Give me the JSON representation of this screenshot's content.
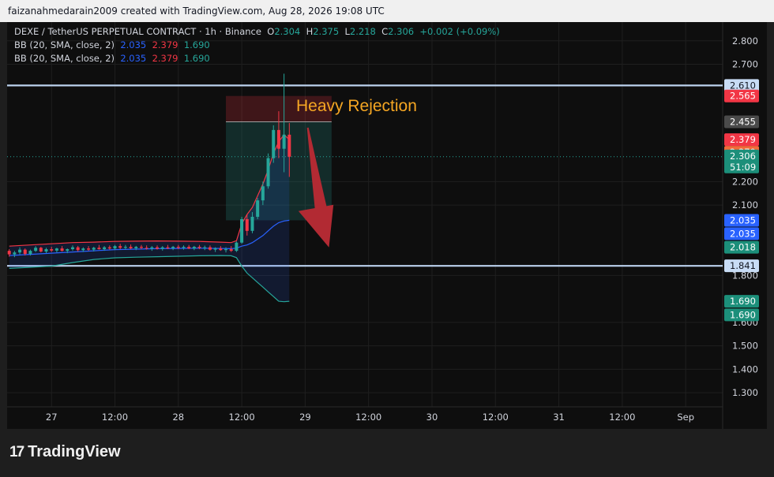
{
  "header": {
    "attribution": "faizanahmedarain2009 created with TradingView.com, Aug 28, 2026 19:08 UTC"
  },
  "legend": {
    "symbol": "DEXE / TetherUS PERPETUAL CONTRACT · 1h · Binance",
    "o_label": "O",
    "o": "2.304",
    "h_label": "H",
    "h": "2.375",
    "l_label": "L",
    "l": "2.218",
    "c_label": "C",
    "c": "2.306",
    "change": "+0.002 (+0.09%)",
    "bb": [
      {
        "label": "BB (20, SMA, close, 2)",
        "basis": "2.035",
        "upper": "2.379",
        "lower": "1.690"
      },
      {
        "label": "BB (20, SMA, close, 2)",
        "basis": "2.035",
        "upper": "2.379",
        "lower": "1.690"
      }
    ]
  },
  "annotation": {
    "text": "Heavy Rejection",
    "color": "#f5a623"
  },
  "footer": {
    "brand": "TradingView",
    "brand_mark": "17"
  },
  "colors": {
    "up": "#26a69a",
    "down": "#f23645",
    "bb_basis": "#2962ff",
    "bb_upper": "#f23645",
    "bb_lower": "#26a69a",
    "hline": "#bcd2ee",
    "arrow": "#b22a33"
  },
  "chart_data": {
    "type": "candlestick",
    "symbol": "DEXE / TetherUS PERPETUAL CONTRACT",
    "interval": "1h",
    "exchange": "Binance",
    "y_ticks": [
      1.3,
      1.4,
      1.5,
      1.6,
      1.8,
      2.1,
      2.2,
      2.7,
      2.8
    ],
    "y_tick_labels": [
      "1.300",
      "1.400",
      "1.500",
      "1.600",
      "1.800",
      "2.100",
      "2.200",
      "2.700",
      "2.800"
    ],
    "ylim": [
      1.24,
      2.88
    ],
    "x_ticks": [
      {
        "label": "27",
        "t": 0
      },
      {
        "label": "12:00",
        "t": 12
      },
      {
        "label": "28",
        "t": 24
      },
      {
        "label": "12:00",
        "t": 36
      },
      {
        "label": "29",
        "t": 48
      },
      {
        "label": "12:00",
        "t": 60
      },
      {
        "label": "30",
        "t": 72
      },
      {
        "label": "12:00",
        "t": 84
      },
      {
        "label": "31",
        "t": 96
      },
      {
        "label": "12:00",
        "t": 108
      },
      {
        "label": "Sep",
        "t": 120
      }
    ],
    "xlim": [
      -8.4,
      127
    ],
    "horizontal_lines": [
      2.61,
      1.841
    ],
    "current_price": 2.306,
    "price_labels": [
      {
        "text": "2.610",
        "value": 2.61,
        "bg": "#c8dcf5",
        "fg": "#131722"
      },
      {
        "text": "2.565",
        "value": 2.565,
        "bg": "#f23645",
        "fg": "#ffffff"
      },
      {
        "text": "2.455",
        "value": 2.455,
        "bg": "#4a4a4a",
        "fg": "#ffffff"
      },
      {
        "text": "2.379",
        "value": 2.379,
        "bg": "#f23645",
        "fg": "#ffffff"
      },
      {
        "text": "2.379",
        "value": 2.325,
        "bg": "#f26a3a",
        "fg": "#ffffff"
      },
      {
        "text": "2.306",
        "value": 2.306,
        "bg": "#1c8f7a",
        "fg": "#ffffff",
        "sub": "51:09"
      },
      {
        "text": "2.035",
        "value": 2.035,
        "bg": "#2962ff",
        "fg": "#ffffff"
      },
      {
        "text": "2.035",
        "value": 1.978,
        "bg": "#2962ff",
        "fg": "#ffffff"
      },
      {
        "text": "2.018",
        "value": 1.92,
        "bg": "#1c8f7a",
        "fg": "#ffffff"
      },
      {
        "text": "1.841",
        "value": 1.841,
        "bg": "#c8dcf5",
        "fg": "#131722"
      },
      {
        "text": "1.690",
        "value": 1.69,
        "bg": "#1c8f7a",
        "fg": "#ffffff"
      },
      {
        "text": "1.690",
        "value": 1.632,
        "bg": "#1c8f7a",
        "fg": "#ffffff"
      }
    ],
    "position": {
      "t_start": 33,
      "t_end": 53,
      "stop": 2.565,
      "entry": 2.455,
      "target": 2.035
    },
    "candles": [
      {
        "t": -8,
        "o": 1.905,
        "h": 1.912,
        "l": 1.88,
        "c": 1.89
      },
      {
        "t": -7,
        "o": 1.89,
        "h": 1.905,
        "l": 1.878,
        "c": 1.898
      },
      {
        "t": -6,
        "o": 1.898,
        "h": 1.92,
        "l": 1.89,
        "c": 1.91
      },
      {
        "t": -5,
        "o": 1.91,
        "h": 1.915,
        "l": 1.885,
        "c": 1.892
      },
      {
        "t": -4,
        "o": 1.892,
        "h": 1.91,
        "l": 1.885,
        "c": 1.905
      },
      {
        "t": -3,
        "o": 1.905,
        "h": 1.925,
        "l": 1.9,
        "c": 1.918
      },
      {
        "t": -2,
        "o": 1.918,
        "h": 1.922,
        "l": 1.898,
        "c": 1.902
      },
      {
        "t": -1,
        "o": 1.902,
        "h": 1.918,
        "l": 1.895,
        "c": 1.912
      },
      {
        "t": 0,
        "o": 1.912,
        "h": 1.922,
        "l": 1.9,
        "c": 1.906
      },
      {
        "t": 1,
        "o": 1.906,
        "h": 1.918,
        "l": 1.898,
        "c": 1.915
      },
      {
        "t": 2,
        "o": 1.915,
        "h": 1.925,
        "l": 1.902,
        "c": 1.905
      },
      {
        "t": 3,
        "o": 1.905,
        "h": 1.915,
        "l": 1.895,
        "c": 1.912
      },
      {
        "t": 4,
        "o": 1.912,
        "h": 1.928,
        "l": 1.905,
        "c": 1.92
      },
      {
        "t": 5,
        "o": 1.92,
        "h": 1.926,
        "l": 1.902,
        "c": 1.908
      },
      {
        "t": 6,
        "o": 1.908,
        "h": 1.92,
        "l": 1.9,
        "c": 1.915
      },
      {
        "t": 7,
        "o": 1.915,
        "h": 1.925,
        "l": 1.905,
        "c": 1.91
      },
      {
        "t": 8,
        "o": 1.91,
        "h": 1.922,
        "l": 1.902,
        "c": 1.918
      },
      {
        "t": 9,
        "o": 1.918,
        "h": 1.93,
        "l": 1.91,
        "c": 1.912
      },
      {
        "t": 10,
        "o": 1.912,
        "h": 1.925,
        "l": 1.905,
        "c": 1.92
      },
      {
        "t": 11,
        "o": 1.92,
        "h": 1.928,
        "l": 1.91,
        "c": 1.915
      },
      {
        "t": 12,
        "o": 1.915,
        "h": 1.93,
        "l": 1.908,
        "c": 1.925
      },
      {
        "t": 13,
        "o": 1.925,
        "h": 1.935,
        "l": 1.912,
        "c": 1.918
      },
      {
        "t": 14,
        "o": 1.918,
        "h": 1.93,
        "l": 1.91,
        "c": 1.922
      },
      {
        "t": 15,
        "o": 1.922,
        "h": 1.932,
        "l": 1.912,
        "c": 1.916
      },
      {
        "t": 16,
        "o": 1.916,
        "h": 1.926,
        "l": 1.908,
        "c": 1.922
      },
      {
        "t": 17,
        "o": 1.922,
        "h": 1.93,
        "l": 1.912,
        "c": 1.918
      },
      {
        "t": 18,
        "o": 1.918,
        "h": 1.928,
        "l": 1.91,
        "c": 1.915
      },
      {
        "t": 19,
        "o": 1.915,
        "h": 1.925,
        "l": 1.905,
        "c": 1.92
      },
      {
        "t": 20,
        "o": 1.92,
        "h": 1.928,
        "l": 1.91,
        "c": 1.914
      },
      {
        "t": 21,
        "o": 1.914,
        "h": 1.925,
        "l": 1.906,
        "c": 1.92
      },
      {
        "t": 22,
        "o": 1.92,
        "h": 1.93,
        "l": 1.912,
        "c": 1.916
      },
      {
        "t": 23,
        "o": 1.916,
        "h": 1.926,
        "l": 1.908,
        "c": 1.922
      },
      {
        "t": 24,
        "o": 1.922,
        "h": 1.93,
        "l": 1.912,
        "c": 1.918
      },
      {
        "t": 25,
        "o": 1.918,
        "h": 1.928,
        "l": 1.91,
        "c": 1.922
      },
      {
        "t": 26,
        "o": 1.922,
        "h": 1.93,
        "l": 1.912,
        "c": 1.915
      },
      {
        "t": 27,
        "o": 1.915,
        "h": 1.926,
        "l": 1.908,
        "c": 1.922
      },
      {
        "t": 28,
        "o": 1.922,
        "h": 1.93,
        "l": 1.912,
        "c": 1.917
      },
      {
        "t": 29,
        "o": 1.917,
        "h": 1.927,
        "l": 1.908,
        "c": 1.92
      },
      {
        "t": 30,
        "o": 1.92,
        "h": 1.928,
        "l": 1.906,
        "c": 1.91
      },
      {
        "t": 31,
        "o": 1.91,
        "h": 1.92,
        "l": 1.9,
        "c": 1.915
      },
      {
        "t": 32,
        "o": 1.915,
        "h": 1.925,
        "l": 1.905,
        "c": 1.908
      },
      {
        "t": 33,
        "o": 1.908,
        "h": 1.92,
        "l": 1.898,
        "c": 1.912
      },
      {
        "t": 34,
        "o": 1.912,
        "h": 1.925,
        "l": 1.9,
        "c": 1.905
      },
      {
        "t": 35,
        "o": 1.905,
        "h": 1.945,
        "l": 1.9,
        "c": 1.94
      },
      {
        "t": 36,
        "o": 1.94,
        "h": 2.05,
        "l": 1.935,
        "c": 2.04
      },
      {
        "t": 37,
        "o": 2.04,
        "h": 2.06,
        "l": 1.97,
        "c": 1.99
      },
      {
        "t": 38,
        "o": 1.99,
        "h": 2.07,
        "l": 1.98,
        "c": 2.05
      },
      {
        "t": 39,
        "o": 2.05,
        "h": 2.13,
        "l": 2.04,
        "c": 2.12
      },
      {
        "t": 40,
        "o": 2.12,
        "h": 2.2,
        "l": 2.1,
        "c": 2.18
      },
      {
        "t": 41,
        "o": 2.18,
        "h": 2.32,
        "l": 2.17,
        "c": 2.3
      },
      {
        "t": 42,
        "o": 2.3,
        "h": 2.44,
        "l": 2.28,
        "c": 2.42
      },
      {
        "t": 43,
        "o": 2.42,
        "h": 2.5,
        "l": 2.3,
        "c": 2.34
      },
      {
        "t": 44,
        "o": 2.34,
        "h": 2.66,
        "l": 2.24,
        "c": 2.4
      },
      {
        "t": 45,
        "o": 2.4,
        "h": 2.45,
        "l": 2.22,
        "c": 2.306
      }
    ],
    "series": [
      {
        "name": "BB upper",
        "points": [
          [
            -8,
            1.925
          ],
          [
            -4,
            1.93
          ],
          [
            0,
            1.935
          ],
          [
            4,
            1.94
          ],
          [
            8,
            1.942
          ],
          [
            12,
            1.945
          ],
          [
            16,
            1.946
          ],
          [
            20,
            1.947
          ],
          [
            24,
            1.946
          ],
          [
            28,
            1.945
          ],
          [
            32,
            1.942
          ],
          [
            34,
            1.94
          ],
          [
            35,
            1.948
          ],
          [
            36,
            2.02
          ],
          [
            37,
            2.06
          ],
          [
            38,
            2.09
          ],
          [
            39,
            2.14
          ],
          [
            40,
            2.19
          ],
          [
            41,
            2.25
          ],
          [
            42,
            2.32
          ],
          [
            43,
            2.37
          ],
          [
            44,
            2.4
          ],
          [
            45,
            2.379
          ]
        ]
      },
      {
        "name": "BB basis",
        "points": [
          [
            -8,
            1.885
          ],
          [
            -4,
            1.89
          ],
          [
            0,
            1.895
          ],
          [
            4,
            1.9
          ],
          [
            8,
            1.905
          ],
          [
            12,
            1.91
          ],
          [
            16,
            1.912
          ],
          [
            20,
            1.914
          ],
          [
            24,
            1.915
          ],
          [
            28,
            1.916
          ],
          [
            32,
            1.915
          ],
          [
            34,
            1.914
          ],
          [
            35,
            1.916
          ],
          [
            36,
            1.925
          ],
          [
            37,
            1.93
          ],
          [
            38,
            1.94
          ],
          [
            39,
            1.955
          ],
          [
            40,
            1.97
          ],
          [
            41,
            1.99
          ],
          [
            42,
            2.01
          ],
          [
            43,
            2.025
          ],
          [
            44,
            2.032
          ],
          [
            45,
            2.035
          ]
        ]
      },
      {
        "name": "BB lower",
        "points": [
          [
            -8,
            1.83
          ],
          [
            -4,
            1.835
          ],
          [
            0,
            1.84
          ],
          [
            4,
            1.855
          ],
          [
            8,
            1.868
          ],
          [
            12,
            1.875
          ],
          [
            16,
            1.878
          ],
          [
            20,
            1.88
          ],
          [
            24,
            1.882
          ],
          [
            28,
            1.884
          ],
          [
            32,
            1.885
          ],
          [
            34,
            1.884
          ],
          [
            35,
            1.876
          ],
          [
            36,
            1.84
          ],
          [
            37,
            1.81
          ],
          [
            38,
            1.79
          ],
          [
            39,
            1.77
          ],
          [
            40,
            1.75
          ],
          [
            41,
            1.73
          ],
          [
            42,
            1.71
          ],
          [
            43,
            1.69
          ],
          [
            44,
            1.688
          ],
          [
            45,
            1.69
          ]
        ]
      }
    ],
    "arrow": {
      "t_from": 48.5,
      "v_from": 2.43,
      "t_to": 52.5,
      "v_to": 1.92
    }
  }
}
